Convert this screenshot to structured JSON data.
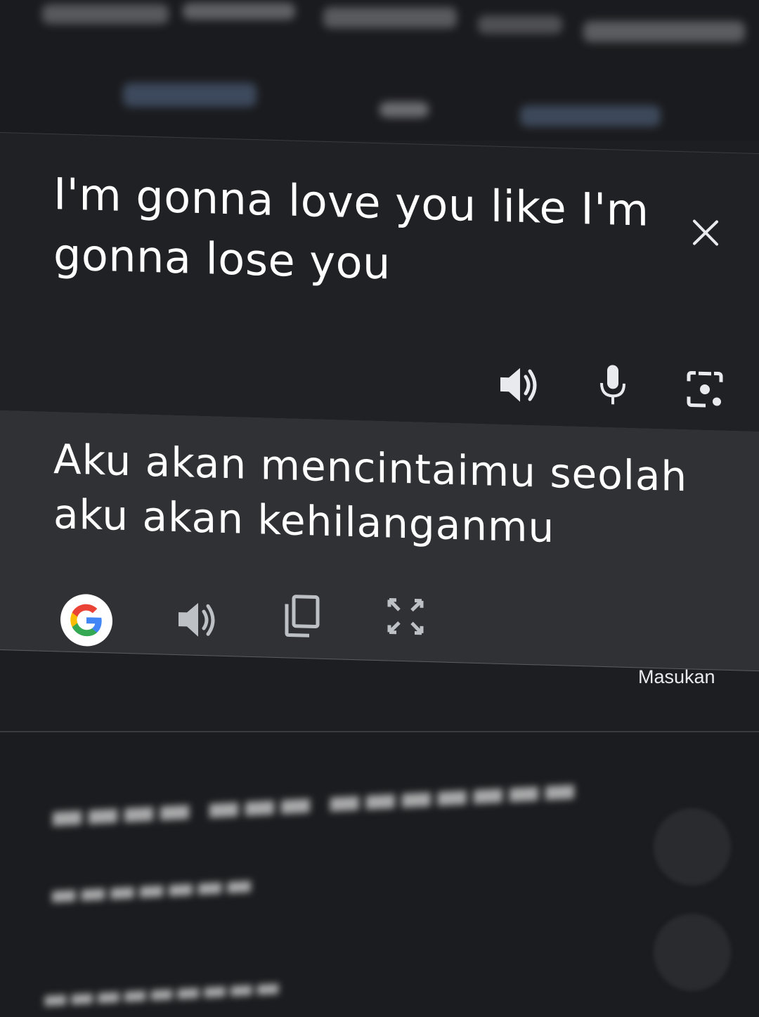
{
  "source": {
    "text": "I'm gonna love you like I'm gonna lose you"
  },
  "target": {
    "text": "Aku akan mencintaimu seolah aku akan kehilanganmu"
  },
  "footer": {
    "feedback_label": "Masukan"
  },
  "icons": {
    "close": "close-icon",
    "source_speak": "speaker-icon",
    "mic": "microphone-icon",
    "camera": "camera-lens-icon",
    "google": "google-logo-icon",
    "target_speak": "speaker-icon",
    "copy": "copy-icon",
    "fullscreen": "fullscreen-icon"
  },
  "colors": {
    "source_bg": "#202124",
    "target_bg": "#303134",
    "text": "#ffffff",
    "icon": "#e8eaed"
  }
}
